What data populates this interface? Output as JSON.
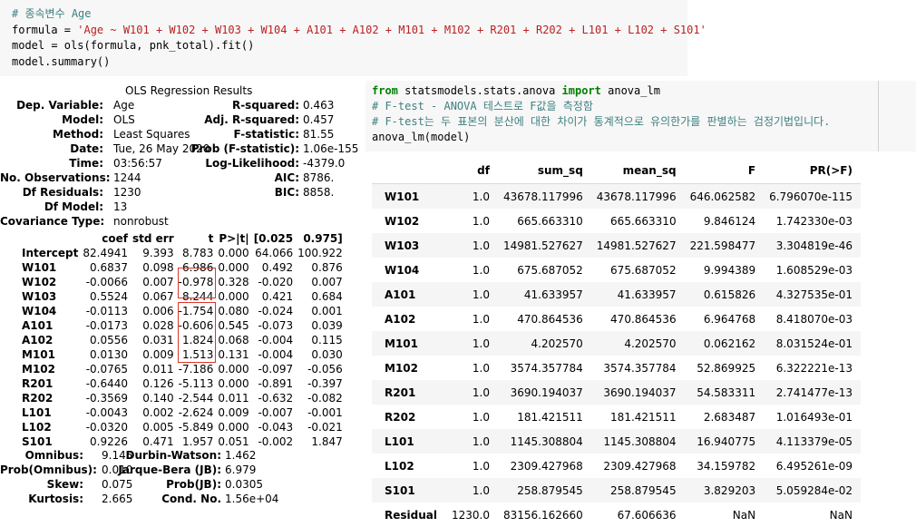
{
  "code_cell_1": {
    "comment": "# 종속변수 Age",
    "formula_lhs": "formula = ",
    "formula_str": "'Age ~ W101 + W102 + W103 + W104 + A101 + A102 + M101 + M102 + R201 + R202 + L101 + L102 + S101'",
    "model_line": "model = ols(formula, pnk_total).fit()",
    "summary_line": "model.summary()"
  },
  "ols": {
    "title": "OLS Regression Results",
    "left": [
      {
        "label": "Dep. Variable:",
        "value": "Age"
      },
      {
        "label": "Model:",
        "value": "OLS"
      },
      {
        "label": "Method:",
        "value": "Least Squares"
      },
      {
        "label": "Date:",
        "value": "Tue, 26 May 2020"
      },
      {
        "label": "Time:",
        "value": "03:56:57"
      },
      {
        "label": "No. Observations:",
        "value": "1244"
      },
      {
        "label": "Df Residuals:",
        "value": "1230"
      },
      {
        "label": "Df Model:",
        "value": "13"
      },
      {
        "label": "Covariance Type:",
        "value": "nonrobust"
      }
    ],
    "right": [
      {
        "label": "R-squared:",
        "value": "0.463"
      },
      {
        "label": "Adj. R-squared:",
        "value": "0.457"
      },
      {
        "label": "F-statistic:",
        "value": "81.55"
      },
      {
        "label": "Prob (F-statistic):",
        "value": "1.06e-155"
      },
      {
        "label": "Log-Likelihood:",
        "value": "-4379.0"
      },
      {
        "label": "AIC:",
        "value": "8786."
      },
      {
        "label": "BIC:",
        "value": "8858."
      }
    ],
    "coef_headers": [
      "",
      "coef",
      "std err",
      "t",
      "P>|t|",
      "[0.025",
      "0.975]"
    ],
    "coef_rows": [
      [
        "Intercept",
        "82.4941",
        "9.393",
        "8.783",
        "0.000",
        "64.066",
        "100.922"
      ],
      [
        "W101",
        "0.6837",
        "0.098",
        "6.986",
        "0.000",
        "0.492",
        "0.876"
      ],
      [
        "W102",
        "-0.0066",
        "0.007",
        "-0.978",
        "0.328",
        "-0.020",
        "0.007"
      ],
      [
        "W103",
        "0.5524",
        "0.067",
        "8.244",
        "0.000",
        "0.421",
        "0.684"
      ],
      [
        "W104",
        "-0.0113",
        "0.006",
        "-1.754",
        "0.080",
        "-0.024",
        "0.001"
      ],
      [
        "A101",
        "-0.0173",
        "0.028",
        "-0.606",
        "0.545",
        "-0.073",
        "0.039"
      ],
      [
        "A102",
        "0.0556",
        "0.031",
        "1.824",
        "0.068",
        "-0.004",
        "0.115"
      ],
      [
        "M101",
        "0.0130",
        "0.009",
        "1.513",
        "0.131",
        "-0.004",
        "0.030"
      ],
      [
        "M102",
        "-0.0765",
        "0.011",
        "-7.186",
        "0.000",
        "-0.097",
        "-0.056"
      ],
      [
        "R201",
        "-0.6440",
        "0.126",
        "-5.113",
        "0.000",
        "-0.891",
        "-0.397"
      ],
      [
        "R202",
        "-0.3569",
        "0.140",
        "-2.544",
        "0.011",
        "-0.632",
        "-0.082"
      ],
      [
        "L101",
        "-0.0043",
        "0.002",
        "-2.624",
        "0.009",
        "-0.007",
        "-0.001"
      ],
      [
        "L102",
        "-0.0320",
        "0.005",
        "-5.849",
        "0.000",
        "-0.043",
        "-0.021"
      ],
      [
        "S101",
        "0.9226",
        "0.471",
        "1.957",
        "0.051",
        "-0.002",
        "1.847"
      ]
    ],
    "diag_left": [
      {
        "label": "Omnibus:",
        "value": "9.145"
      },
      {
        "label": "Prob(Omnibus):",
        "value": "0.010"
      },
      {
        "label": "Skew:",
        "value": "0.075"
      },
      {
        "label": "Kurtosis:",
        "value": "2.665"
      }
    ],
    "diag_right": [
      {
        "label": "Durbin-Watson:",
        "value": "1.462"
      },
      {
        "label": "Jarque-Bera (JB):",
        "value": "6.979"
      },
      {
        "label": "Prob(JB):",
        "value": "0.0305"
      },
      {
        "label": "Cond. No.",
        "value": "1.56e+04"
      }
    ]
  },
  "code_cell_2": {
    "import_from": "from",
    "import_module": " statsmodels.stats.anova ",
    "import_kw": "import",
    "import_name": " anova_lm",
    "comment1": "# F-test - ANOVA 테스트로 F값을 측정함",
    "comment2": "# F-test는 두 표본의 분산에 대한 차이가 통계적으로 유의한가를 판별하는 검정기법입니다.",
    "call": "anova_lm(model)"
  },
  "anova": {
    "headers": [
      "",
      "df",
      "sum_sq",
      "mean_sq",
      "F",
      "PR(>F)"
    ],
    "rows": [
      [
        "W101",
        "1.0",
        "43678.117996",
        "43678.117996",
        "646.062582",
        "6.796070e-115"
      ],
      [
        "W102",
        "1.0",
        "665.663310",
        "665.663310",
        "9.846124",
        "1.742330e-03"
      ],
      [
        "W103",
        "1.0",
        "14981.527627",
        "14981.527627",
        "221.598477",
        "3.304819e-46"
      ],
      [
        "W104",
        "1.0",
        "675.687052",
        "675.687052",
        "9.994389",
        "1.608529e-03"
      ],
      [
        "A101",
        "1.0",
        "41.633957",
        "41.633957",
        "0.615826",
        "4.327535e-01"
      ],
      [
        "A102",
        "1.0",
        "470.864536",
        "470.864536",
        "6.964768",
        "8.418070e-03"
      ],
      [
        "M101",
        "1.0",
        "4.202570",
        "4.202570",
        "0.062162",
        "8.031524e-01"
      ],
      [
        "M102",
        "1.0",
        "3574.357784",
        "3574.357784",
        "52.869925",
        "6.322221e-13"
      ],
      [
        "R201",
        "1.0",
        "3690.194037",
        "3690.194037",
        "54.583311",
        "2.741477e-13"
      ],
      [
        "R202",
        "1.0",
        "181.421511",
        "181.421511",
        "2.683487",
        "1.016493e-01"
      ],
      [
        "L101",
        "1.0",
        "1145.308804",
        "1145.308804",
        "16.940775",
        "4.113379e-05"
      ],
      [
        "L102",
        "1.0",
        "2309.427968",
        "2309.427968",
        "34.159782",
        "6.495261e-09"
      ],
      [
        "S101",
        "1.0",
        "258.879545",
        "258.879545",
        "3.829203",
        "5.059284e-02"
      ],
      [
        "Residual",
        "1230.0",
        "83156.162660",
        "67.606636",
        "NaN",
        "NaN"
      ]
    ]
  },
  "colors": {
    "code_bg": "#f7f7f7",
    "comment": "#408080",
    "string": "#ba2121",
    "keyword": "#008000",
    "highlight_box": "#d9362b"
  }
}
